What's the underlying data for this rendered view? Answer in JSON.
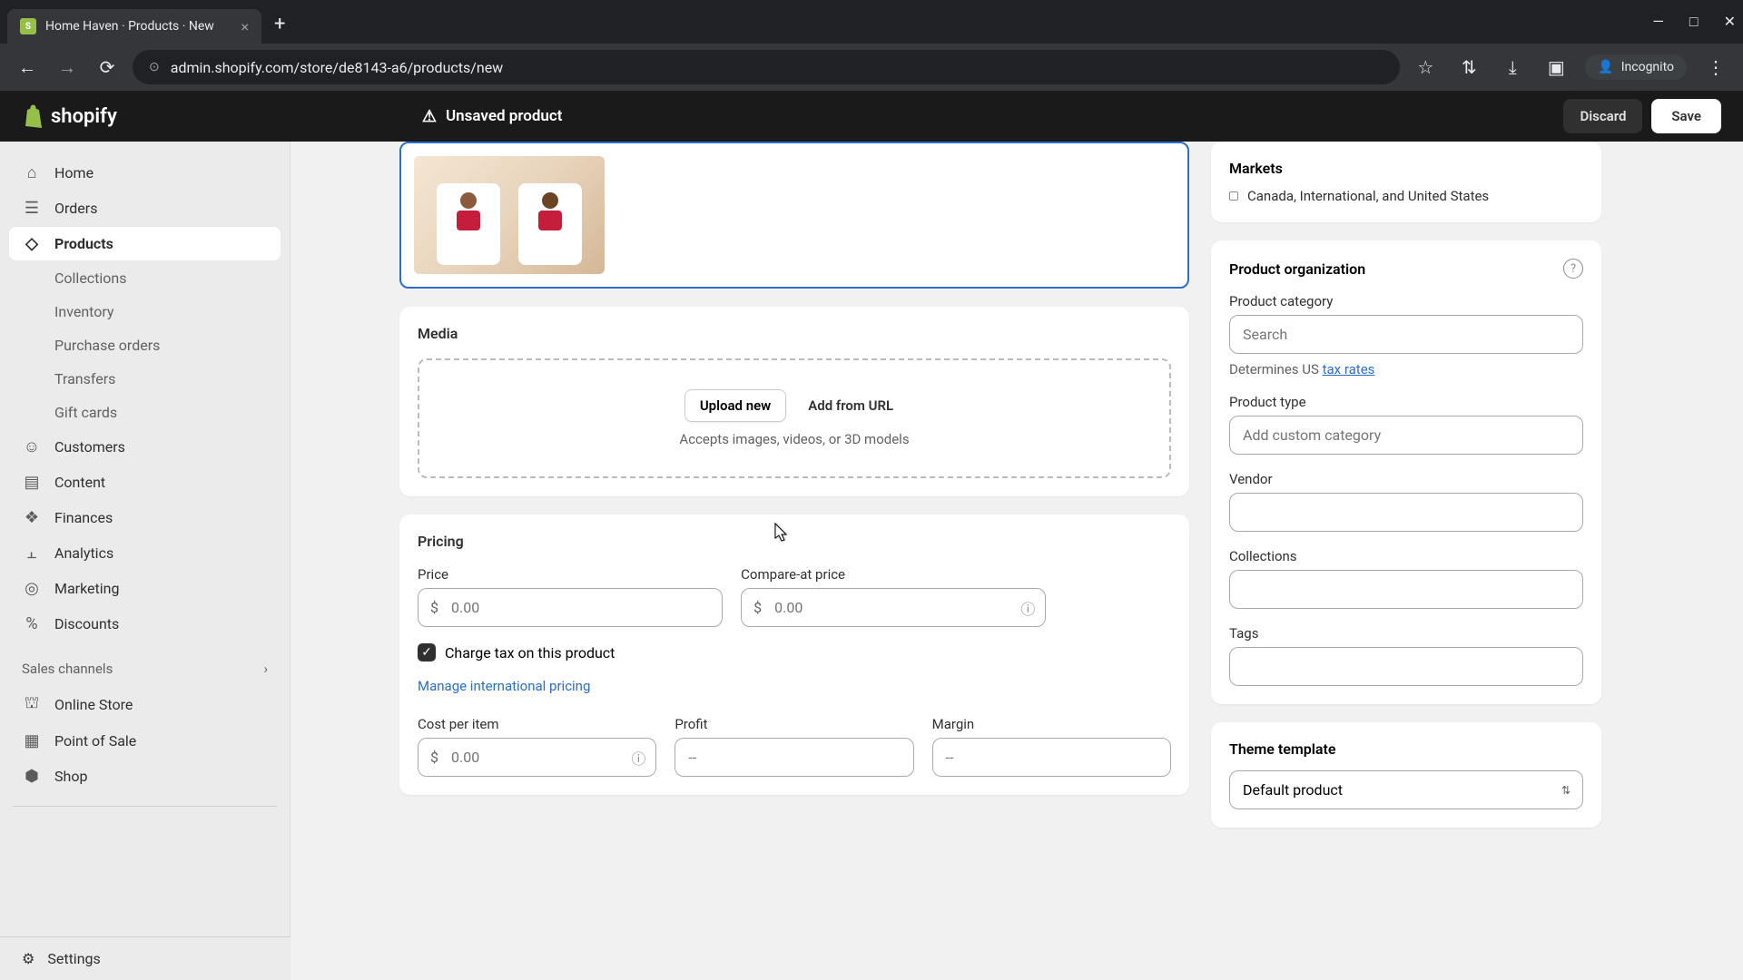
{
  "browser": {
    "tab_title": "Home Haven · Products · New",
    "url": "admin.shopify.com/store/de8143-a6/products/new",
    "incognito_label": "Incognito"
  },
  "app_bar": {
    "logo_text": "shopify",
    "unsaved_label": "Unsaved product",
    "discard_label": "Discard",
    "save_label": "Save"
  },
  "sidebar": {
    "home": "Home",
    "orders": "Orders",
    "products": "Products",
    "collections": "Collections",
    "inventory": "Inventory",
    "purchase_orders": "Purchase orders",
    "transfers": "Transfers",
    "gift_cards": "Gift cards",
    "customers": "Customers",
    "content": "Content",
    "finances": "Finances",
    "analytics": "Analytics",
    "marketing": "Marketing",
    "discounts": "Discounts",
    "sales_channels": "Sales channels",
    "online_store": "Online Store",
    "point_of_sale": "Point of Sale",
    "shop": "Shop",
    "settings": "Settings"
  },
  "media": {
    "title": "Media",
    "upload_label": "Upload new",
    "url_label": "Add from URL",
    "hint": "Accepts images, videos, or 3D models"
  },
  "pricing": {
    "title": "Pricing",
    "price_label": "Price",
    "price_placeholder": "0.00",
    "compare_label": "Compare-at price",
    "compare_placeholder": "0.00",
    "tax_label": "Charge tax on this product",
    "intl_link": "Manage international pricing",
    "cost_label": "Cost per item",
    "cost_placeholder": "0.00",
    "profit_label": "Profit",
    "profit_placeholder": "--",
    "margin_label": "Margin",
    "margin_placeholder": "--",
    "currency": "$"
  },
  "markets": {
    "title": "Markets",
    "value": "Canada, International, and United States"
  },
  "organization": {
    "title": "Product organization",
    "category_label": "Product category",
    "category_placeholder": "Search",
    "tax_hint_prefix": "Determines US ",
    "tax_link": "tax rates",
    "type_label": "Product type",
    "type_placeholder": "Add custom category",
    "vendor_label": "Vendor",
    "collections_label": "Collections",
    "tags_label": "Tags"
  },
  "theme": {
    "title": "Theme template",
    "value": "Default product"
  }
}
